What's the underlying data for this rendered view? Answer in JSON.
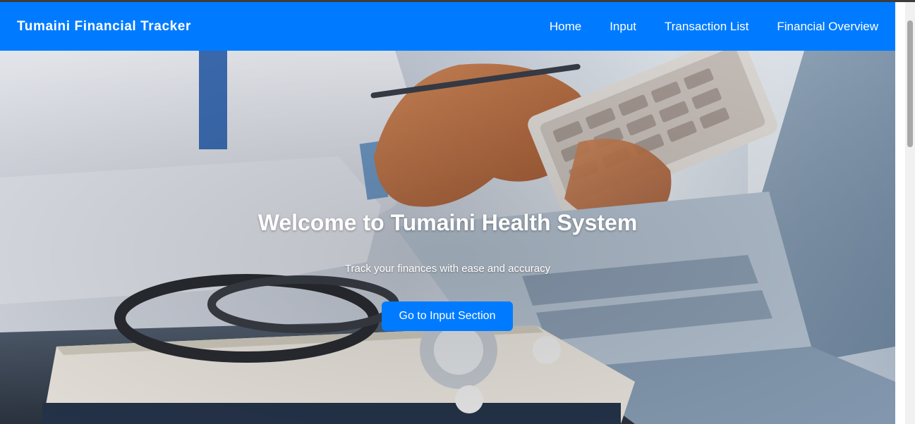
{
  "navbar": {
    "brand": "Tumaini Financial Tracker",
    "links": [
      {
        "label": "Home"
      },
      {
        "label": "Input"
      },
      {
        "label": "Transaction List"
      },
      {
        "label": "Financial Overview"
      }
    ]
  },
  "hero": {
    "title": "Welcome to Tumaini Health System",
    "subtitle": "Track your finances with ease and accuracy",
    "cta_label": "Go to Input Section",
    "background_image": "doctor-with-calculator-stethoscope-laptop"
  },
  "colors": {
    "primary": "#007bff",
    "text_on_primary": "#ffffff"
  }
}
